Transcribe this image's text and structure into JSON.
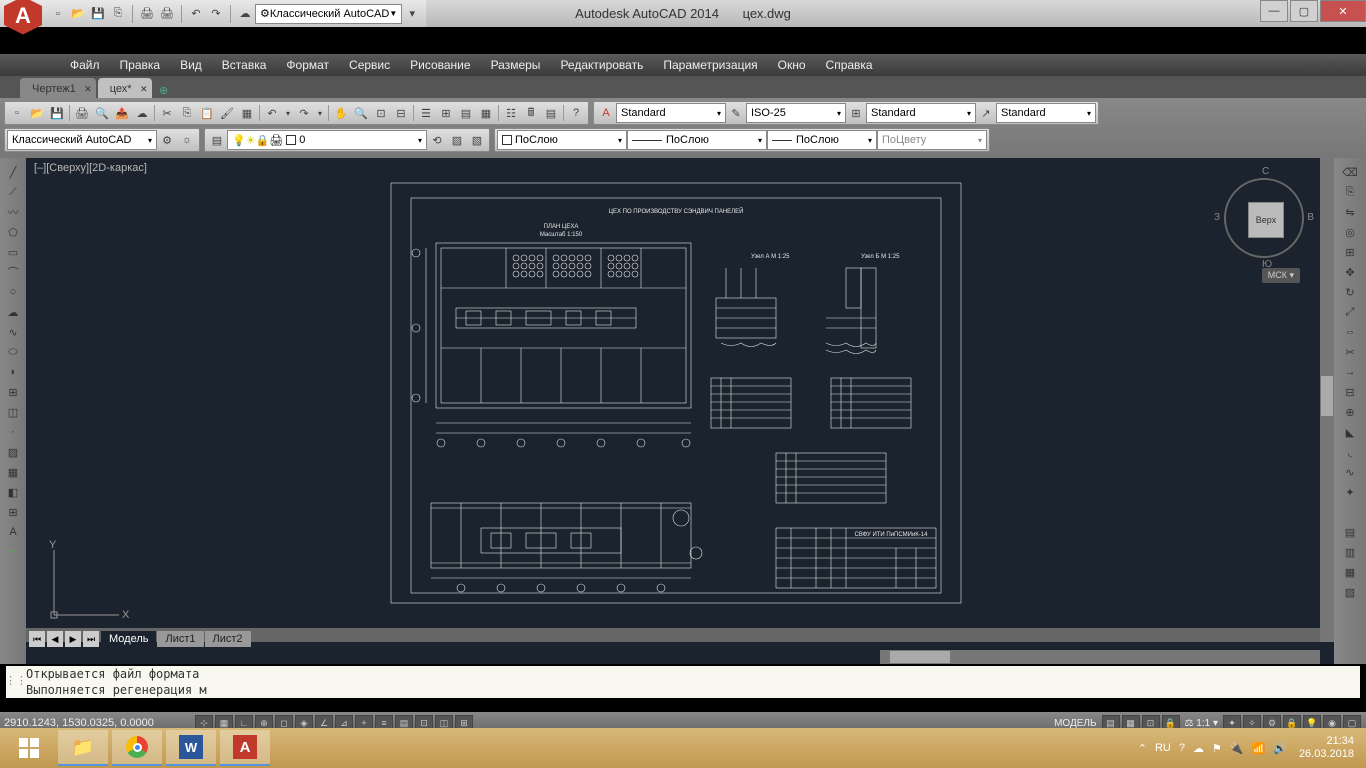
{
  "window": {
    "app_title": "Autodesk AutoCAD 2014",
    "file_name": "цех.dwg",
    "min": "—",
    "max": "▢",
    "close": "✕"
  },
  "qat": {
    "workspace": "Классический AutoCAD",
    "icons": [
      "new",
      "open",
      "save",
      "saveas",
      "plot",
      "undo",
      "redo",
      "cloud"
    ]
  },
  "menu": {
    "items": [
      "Файл",
      "Правка",
      "Вид",
      "Вставка",
      "Формат",
      "Сервис",
      "Рисование",
      "Размеры",
      "Редактировать",
      "Параметризация",
      "Окно",
      "Справка"
    ]
  },
  "file_tabs": [
    {
      "label": "Чертеж1",
      "active": false
    },
    {
      "label": "цех*",
      "active": true
    }
  ],
  "toolbar": {
    "text_style": "Standard",
    "dim_style": "ISO-25",
    "table_style": "Standard",
    "mleader_style": "Standard",
    "workspace2": "Классический AutoCAD",
    "layer": "0",
    "ltype": "ПоСлою",
    "lweight": "ПоСлою",
    "plotstyle": "ПоСлою",
    "color": "ПоЦвету"
  },
  "view": {
    "label": "[–][Сверху][2D-каркас]",
    "cube_face": "Верх",
    "cube_n": "С",
    "cube_s": "Ю",
    "cube_e": "В",
    "cube_w": "З",
    "wcs": "МСК",
    "ucs_x": "X",
    "ucs_y": "Y"
  },
  "drawing": {
    "title": "ЦЕХ ПО ПРОИЗВОДСТВУ СЭНДВИЧ ПАНЕЛЕЙ",
    "subtitle": "ПЛАН ЦЕХА",
    "scale": "Масштаб 1:150",
    "detail_a": "Узел А  М 1:25",
    "detail_b": "Узел Б  М 1:25",
    "stamp": "СВФУ ИТИ ПиПСМИиК-14"
  },
  "layout_tabs": [
    "Модель",
    "Лист1",
    "Лист2"
  ],
  "command": {
    "line1": "Открывается файл формата",
    "line2": "Выполняется регенерация м"
  },
  "status": {
    "coords": "2910.1243, 1530.0325, 0.0000",
    "model": "МОДЕЛЬ",
    "scale": "1:1",
    "lang": "RU"
  },
  "tray": {
    "lang": "RU",
    "time": "21:34",
    "date": "26.03.2018"
  }
}
